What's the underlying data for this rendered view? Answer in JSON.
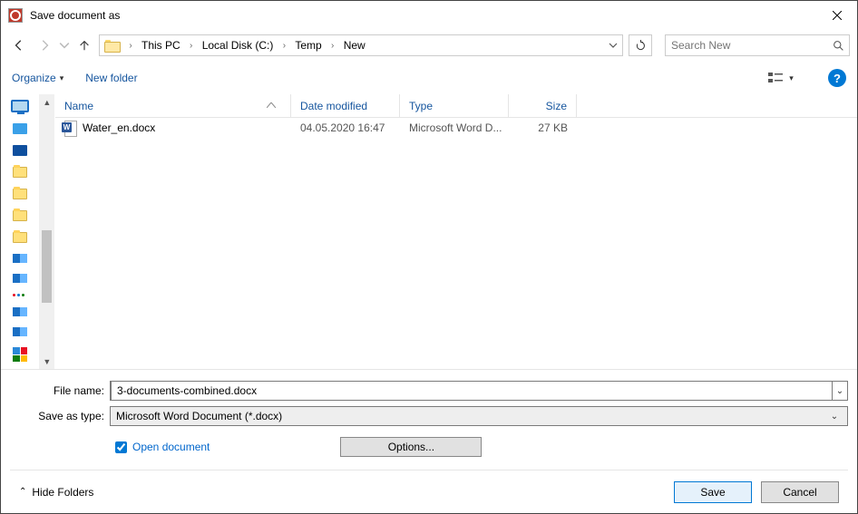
{
  "window": {
    "title": "Save document as"
  },
  "breadcrumb": {
    "items": [
      "This PC",
      "Local Disk (C:)",
      "Temp",
      "New"
    ]
  },
  "search": {
    "placeholder": "Search New"
  },
  "toolbar": {
    "organize": "Organize",
    "new_folder": "New folder"
  },
  "columns": {
    "name": "Name",
    "date": "Date modified",
    "type": "Type",
    "size": "Size"
  },
  "files": [
    {
      "name": "Water_en.docx",
      "date": "04.05.2020 16:47",
      "type": "Microsoft Word D...",
      "size": "27 KB"
    }
  ],
  "form": {
    "filename_label": "File name:",
    "filename_value": "3-documents-combined.docx",
    "filetype_label": "Save as type:",
    "filetype_value": "Microsoft Word Document (*.docx)",
    "open_document": "Open document",
    "options": "Options..."
  },
  "footer": {
    "hide_folders": "Hide Folders",
    "save": "Save",
    "cancel": "Cancel"
  }
}
